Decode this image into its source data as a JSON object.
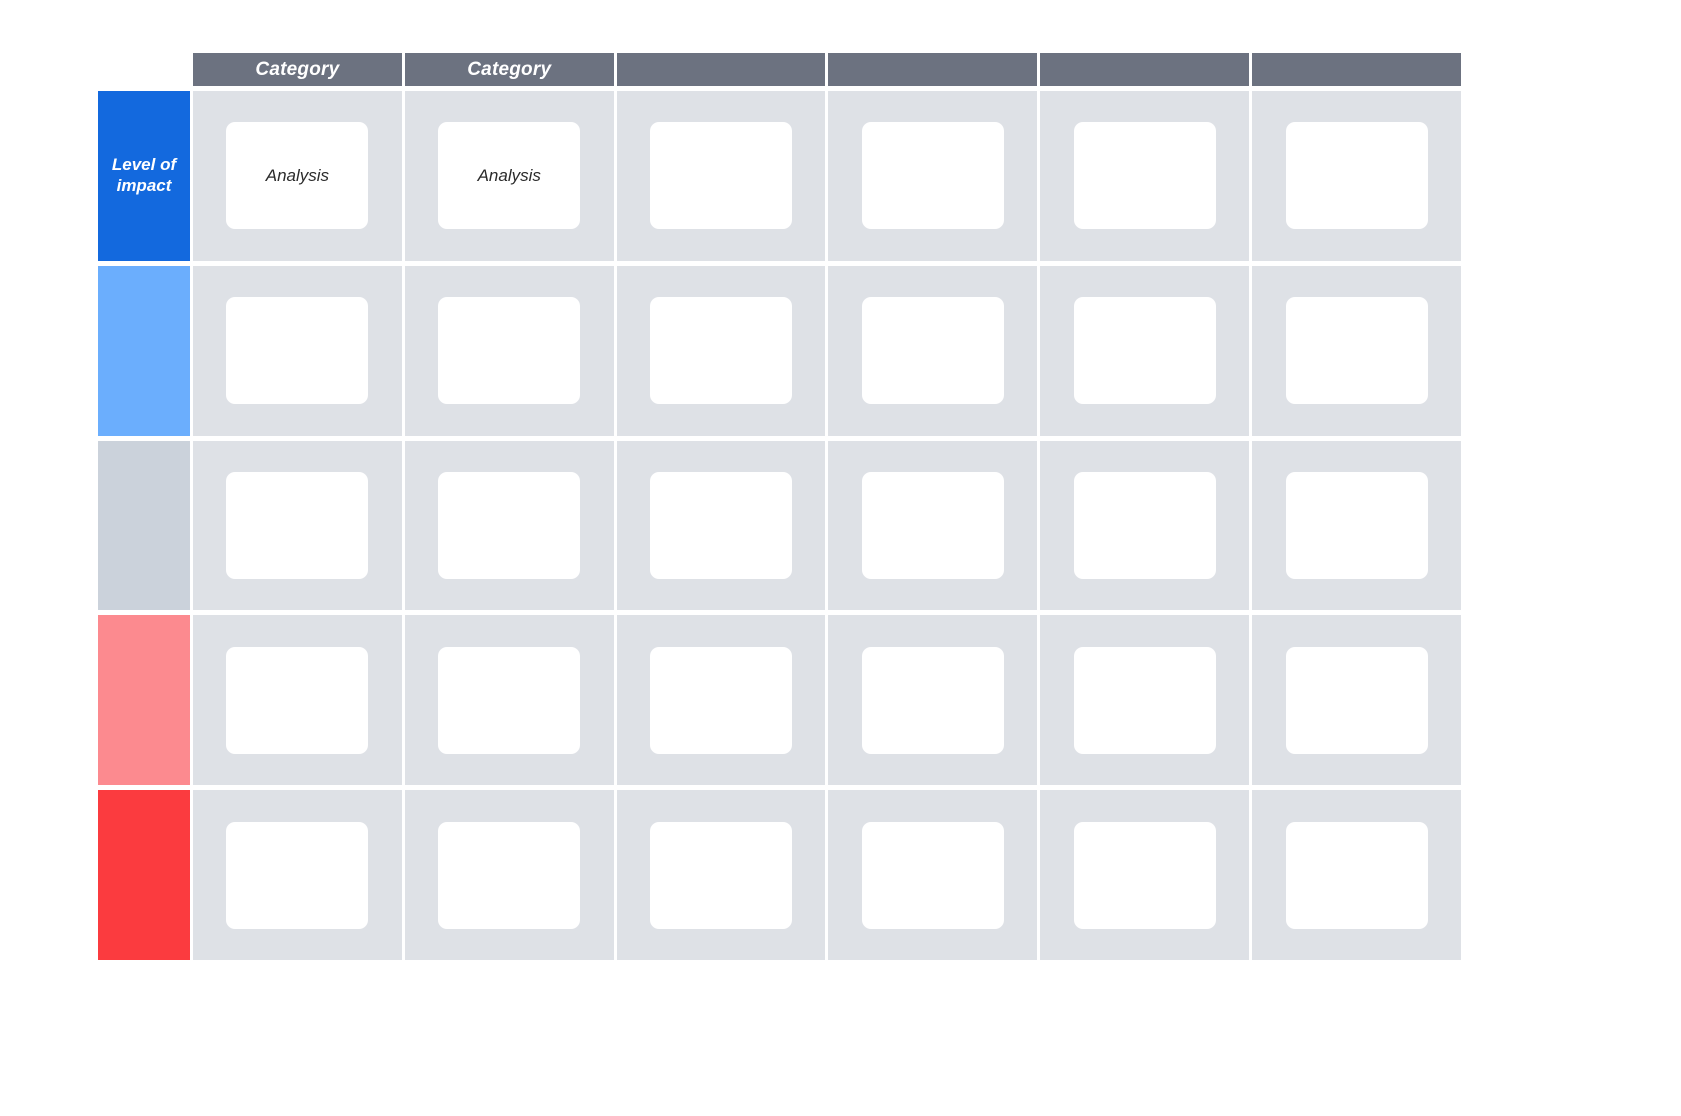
{
  "diagram": {
    "type": "impact-category-matrix",
    "colors": {
      "header_bar": "#6C7280",
      "cell_background": "#DEE1E6",
      "card": "#FFFFFF",
      "page_background": "#FFFFFF",
      "header_text": "#FFFFFF",
      "label_text": "#FFFFFF",
      "card_text": "#2B2B2B"
    },
    "column_headers": [
      {
        "label": "Category"
      },
      {
        "label": "Category"
      },
      {
        "label": ""
      },
      {
        "label": ""
      },
      {
        "label": ""
      },
      {
        "label": ""
      }
    ],
    "row_labels": [
      {
        "label": "Level of\nimpact",
        "color": "#1369DE"
      },
      {
        "label": "",
        "color": "#6BAEFD"
      },
      {
        "label": "",
        "color": "#CBD2DB"
      },
      {
        "label": "",
        "color": "#FC8A8F"
      },
      {
        "label": "",
        "color": "#FB3B3F"
      }
    ],
    "rows": [
      {
        "cells": [
          "Analysis",
          "Analysis",
          "",
          "",
          "",
          ""
        ]
      },
      {
        "cells": [
          "",
          "",
          "",
          "",
          "",
          ""
        ]
      },
      {
        "cells": [
          "",
          "",
          "",
          "",
          "",
          ""
        ]
      },
      {
        "cells": [
          "",
          "",
          "",
          "",
          "",
          ""
        ]
      },
      {
        "cells": [
          "",
          "",
          "",
          "",
          "",
          ""
        ]
      }
    ]
  }
}
